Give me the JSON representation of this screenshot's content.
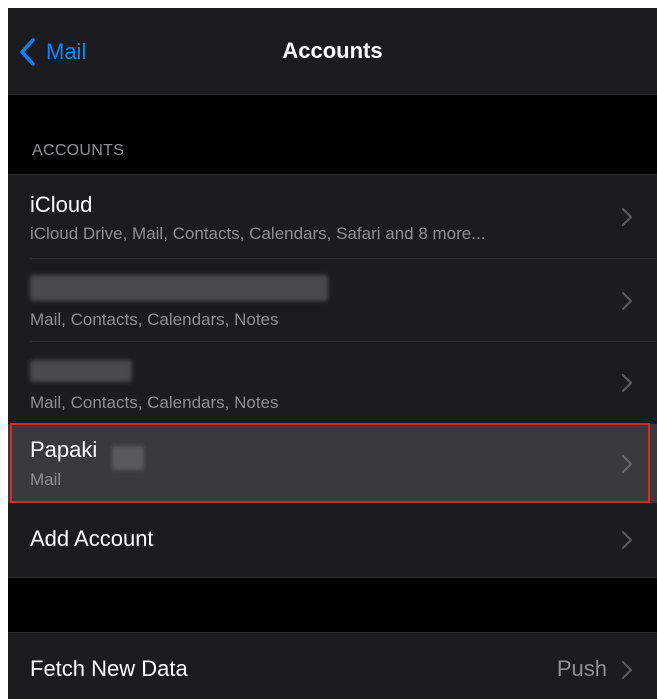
{
  "nav": {
    "back_label": "Mail",
    "title": "Accounts"
  },
  "section": {
    "accounts_header": "ACCOUNTS"
  },
  "accounts": [
    {
      "title": "iCloud",
      "subtitle": "iCloud Drive, Mail, Contacts, Calendars, Safari and 8 more..."
    },
    {
      "title": "",
      "subtitle": "Mail, Contacts, Calendars, Notes"
    },
    {
      "title": "",
      "subtitle": "Mail, Contacts, Calendars, Notes"
    },
    {
      "title": "Papaki",
      "subtitle": "Mail"
    }
  ],
  "add_account": {
    "label": "Add Account"
  },
  "fetch": {
    "label": "Fetch New Data",
    "value": "Push"
  },
  "colors": {
    "background": "#000000",
    "cell": "#1c1c1e",
    "highlight_cell": "#3a3a3c",
    "accent": "#0a84ff",
    "secondary_text": "#8e8e93",
    "highlight_border": "#d42a2a"
  },
  "icons": {
    "back": "chevron-left-icon",
    "disclosure": "chevron-right-icon"
  }
}
